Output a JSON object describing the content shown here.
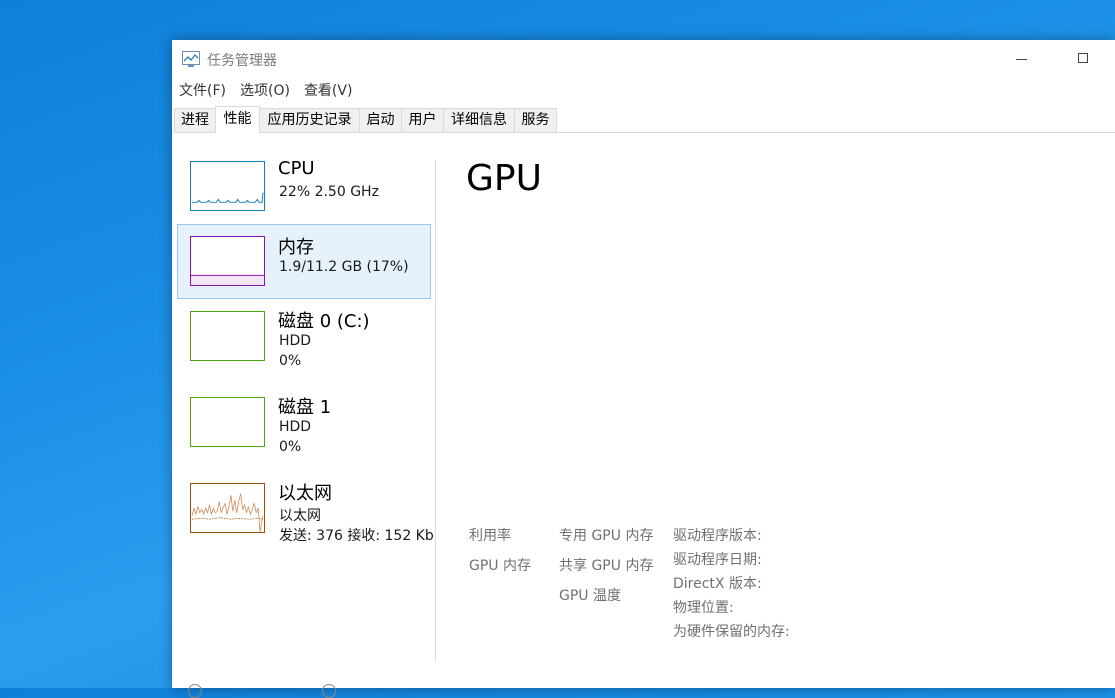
{
  "window": {
    "title": "任务管理器"
  },
  "menu": [
    "文件(F)",
    "选项(O)",
    "查看(V)"
  ],
  "tabs": [
    {
      "label": "进程",
      "active": false
    },
    {
      "label": "性能",
      "active": true
    },
    {
      "label": "应用历史记录",
      "active": false
    },
    {
      "label": "启动",
      "active": false
    },
    {
      "label": "用户",
      "active": false
    },
    {
      "label": "详细信息",
      "active": false
    },
    {
      "label": "服务",
      "active": false
    }
  ],
  "resources": [
    {
      "name": "CPU",
      "line1": "22% 2.50 GHz",
      "line2": "",
      "color": "#117dbb",
      "selected": false
    },
    {
      "name": "内存",
      "line1": "1.9/11.2 GB (17%)",
      "line2": "",
      "color": "#8b12ae",
      "selected": true
    },
    {
      "name": "磁盘 0 (C:)",
      "line1": "HDD",
      "line2": "0%",
      "color": "#4da60c",
      "selected": false
    },
    {
      "name": "磁盘 1",
      "line1": "HDD",
      "line2": "0%",
      "color": "#4da60c",
      "selected": false
    },
    {
      "name": "以太网",
      "line1": "以太网",
      "line2": "发送: 376 接收: 152 Kb",
      "color": "#a74f01",
      "selected": false
    }
  ],
  "detail": {
    "title": "GPU",
    "col1": [
      "利用率",
      "GPU 内存"
    ],
    "col2": [
      "专用 GPU 内存",
      "共享 GPU 内存",
      "GPU 温度"
    ],
    "col3": [
      "驱动程序版本:",
      "驱动程序日期:",
      "DirectX 版本:",
      "物理位置:",
      "为硬件保留的内存:"
    ]
  }
}
